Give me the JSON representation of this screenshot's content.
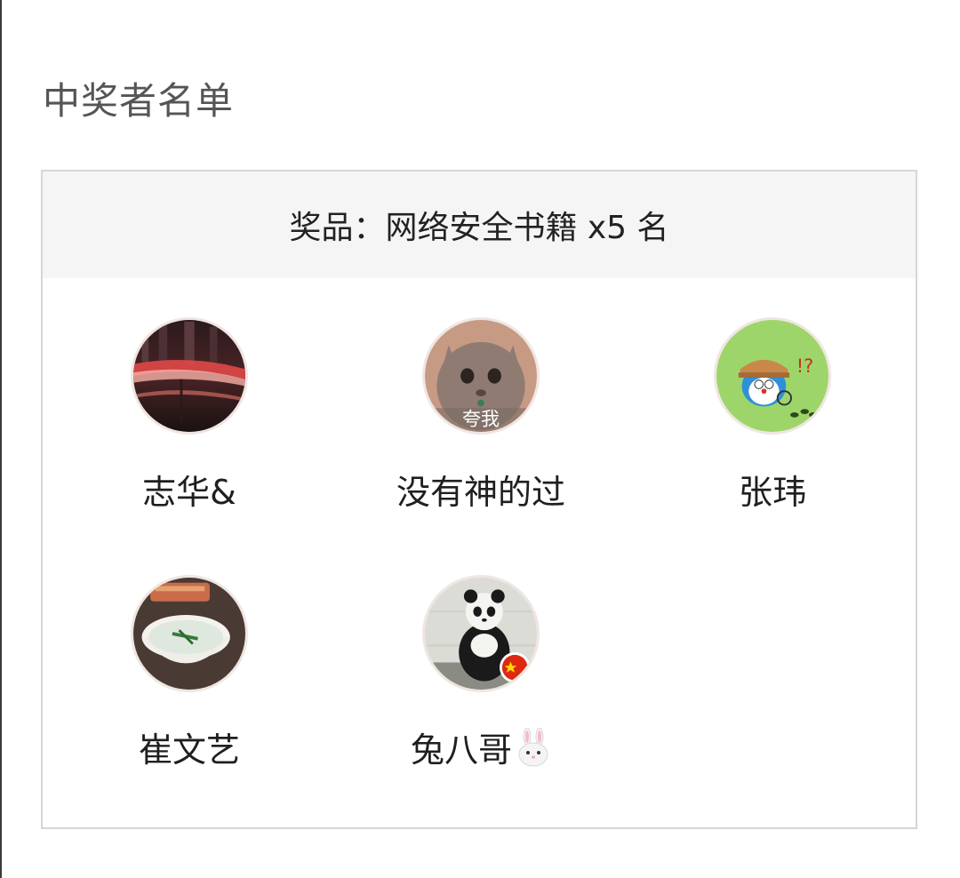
{
  "section": {
    "title": "中奖者名单"
  },
  "prize": {
    "label": "奖品：网络安全书籍 x5 名"
  },
  "winners": [
    {
      "name": "志华&",
      "avatar_icon": "city-night-light-trails-avatar"
    },
    {
      "name": "没有神的过",
      "avatar_icon": "cat-avatar",
      "avatar_caption": "夸我"
    },
    {
      "name": "张玮",
      "avatar_icon": "doraemon-detective-avatar"
    },
    {
      "name": "崔文艺",
      "avatar_icon": "congee-bowl-avatar"
    },
    {
      "name": "兔八哥",
      "avatar_icon": "panda-avatar",
      "name_suffix_icon": "rabbit-face-icon"
    }
  ],
  "colors": {
    "header_bg": "#f5f5f5",
    "border": "#d6d6d6",
    "title_text": "#555555"
  }
}
